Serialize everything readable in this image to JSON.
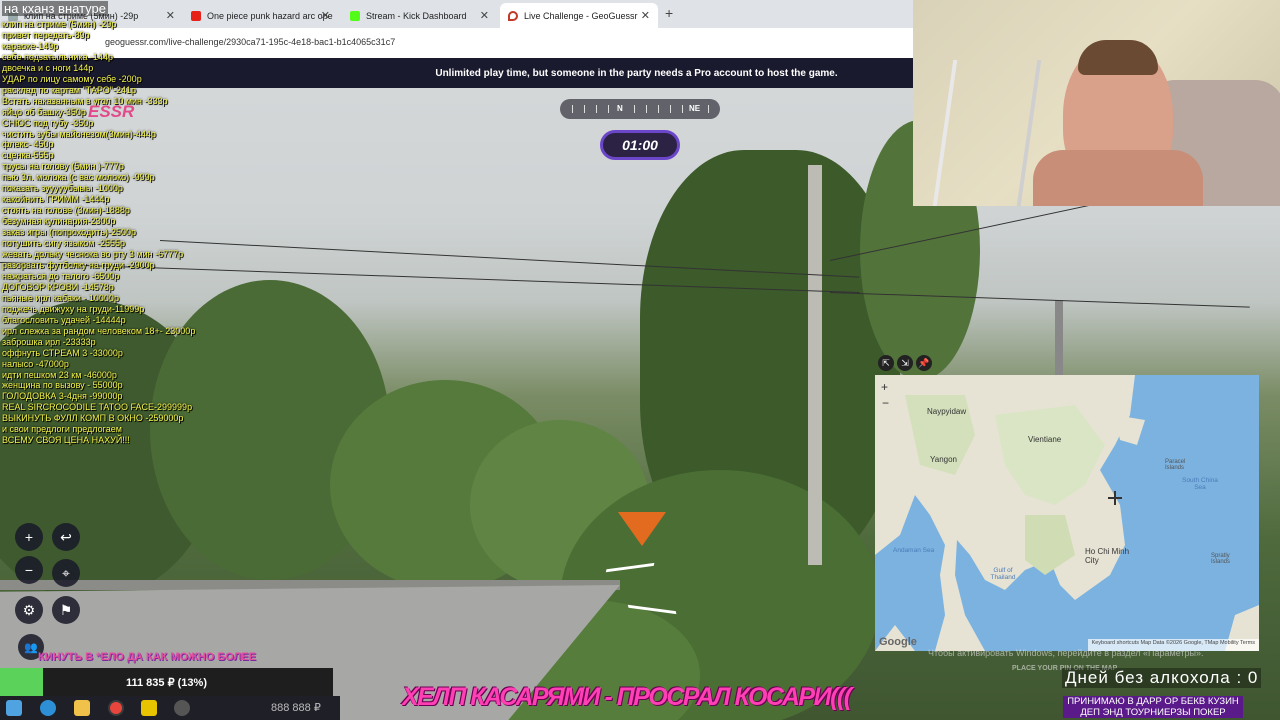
{
  "browser": {
    "tabs": [
      {
        "label": "клип на стриме (5мин) -29р"
      },
      {
        "label": "One piece punk hazard arc ope"
      },
      {
        "label": "Stream - Kick Dashboard"
      },
      {
        "label": "Live Challenge - GeoGuessr"
      }
    ],
    "url": "geoguessr.com/live-challenge/2930ca71-195c-4e18-bac1-b1c4065c31c7"
  },
  "geoguessr": {
    "banner": "Unlimited play time, but someone in the party needs a Pro account to host the game.",
    "logo_fragment": "ESSR",
    "timer": "01:00",
    "compass": {
      "n": "N",
      "ne": "NE"
    },
    "hint": "Чтобы активировать Windows, перейдите в раздел «Параметры».",
    "place_pin": "PLACE YOUR PIN ON THE MAP"
  },
  "donations": {
    "title": "на кханз внатуре",
    "items": [
      "клип на стриме (5мин) -29р",
      "привет передать-89р",
      "караоке-149р",
      "себе подзатыльника -144р",
      "двоечка и с ноги 144р",
      "УДАР по лицу самому себе -200р",
      "расклад по картам \"ТАРО\"-241р",
      "Встать наказанным в угол 10 мин -333р",
      "яйцо об башку-350р",
      "СНЮС под губу -350р",
      "чистить зубы майонезом(3мин)-444р",
      "флекс- 450р",
      "сценка-555р",
      "трусы на голову (5мин )-777р",
      "пью 3л. молока (с вас молоко) -999р",
      "показать зууууубыыы -1000р",
      "какойнить ГРИММ -1444р",
      "стоять на голове (3мин)-1888р",
      "безумная кулинария-2300р",
      "заказ игры (попроходить)-2500р",
      "потушить сигу языком -2555р",
      "жевать дольку чеснока во рту 3 мин -6777р",
      "разорвать футболку на груди -2900р",
      "нажраться до талого -6500р",
      "ДОГОВОР КРОВИ -14578р",
      "пьяные ирл кабаки - 10000р",
      "поджечь движуху на груди-11999р",
      "благословить удачей -14444р",
      "ирл слежка за рандом человеком 18+- 23000р",
      "заброшка ирл -23333р",
      "оффнуть СТРЕАМ 3 -33000р",
      "налысо -47000р",
      "идти пешком 23 км -46000р",
      "женщина по вызову - 55000р",
      "ГОЛОДОВКА 3-4дня -99000р",
      "REAL SIRCROCODILE TATOO FACE-299999р",
      "ВЫКИНУТЬ ФУЛЛ КОМП В ОКНО -259000р",
      "и свои предлоги предлогаем",
      "ВСЕМУ СВОЯ ЦЕНА НАХУЙ!!!"
    ]
  },
  "map": {
    "labels": [
      {
        "text": "Naypyidaw",
        "kind": "city"
      },
      {
        "text": "Vientiane",
        "kind": "city"
      },
      {
        "text": "Yangon",
        "kind": "city"
      },
      {
        "text": "Paracel Islands",
        "kind": "small"
      },
      {
        "text": "South China Sea",
        "kind": "sea"
      },
      {
        "text": "Andaman Sea",
        "kind": "sea"
      },
      {
        "text": "Gulf of Thailand",
        "kind": "sea"
      },
      {
        "text": "Ho Chi Minh City",
        "kind": "city"
      },
      {
        "text": "Spratly Islands",
        "kind": "small"
      }
    ],
    "logo": "Google",
    "attribution": "Keyboard shortcuts   Map Data ©2026 Google, TMap Mobility   Terms"
  },
  "stream": {
    "kinut": "КИНУТЬ В *ЕЛО ДА КАК МОЖНО БОЛЕЕ",
    "progress_text": "111 835 ₽ (13%)",
    "progress_percent": 13,
    "ticker": "ХЕЛП КАСАРЯМИ - ПРОСРАЛ КОСАРИ(((",
    "days_without_alcohol": "Дней  без  алкохола : 0",
    "accepting": "ПРИНИМАЮ В ДАРР ОР БЕКВ КУЗИН ДЕП ЭНД ТОУРНИЕРЗЫ ПОКЕР",
    "taskbar_money": "888 888 ₽"
  },
  "colors": {
    "accent_purple": "#6b46c9",
    "donation_yellow": "#f3f34a",
    "ticker_pink": "#ff3fb4",
    "progress_green": "#5bd35b"
  }
}
